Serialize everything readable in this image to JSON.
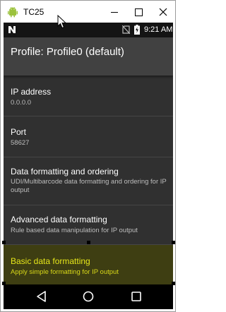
{
  "window": {
    "title": "TC25",
    "icons": [
      "android-icon",
      "minimize-icon",
      "maximize-icon",
      "close-icon",
      "mouse-cursor-icon"
    ]
  },
  "statusbar": {
    "time": "9:21 AM",
    "icons": [
      "notification-n-icon",
      "no-sim-icon",
      "battery-charging-icon"
    ]
  },
  "appbar": {
    "title": "Profile: Profile0 (default)"
  },
  "settings": {
    "items": [
      {
        "title": "IP address",
        "summary": "0.0.0.0"
      },
      {
        "title": "Port",
        "summary": "58627"
      },
      {
        "title": "Data formatting and ordering",
        "summary": "UDI/Multibarcode data formatting and ordering for IP output"
      },
      {
        "title": "Advanced data formatting",
        "summary": "Rule based data manipulation for IP output"
      },
      {
        "title": "Basic data formatting",
        "summary": "Apply simple formatting for IP output",
        "selected": true
      }
    ]
  },
  "navbar": {
    "icons": [
      "back-icon",
      "home-icon",
      "recents-icon"
    ]
  },
  "colors": {
    "background": "#303030",
    "appbar": "#414141",
    "statusbar": "#141414",
    "highlight_background": "#3e3e12",
    "highlight_text": "#e6e61a"
  }
}
